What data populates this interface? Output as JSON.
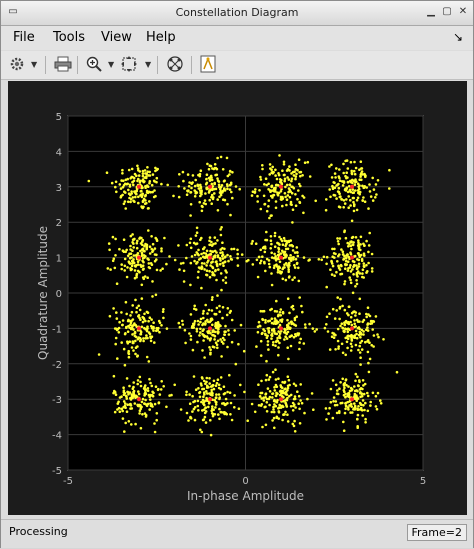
{
  "window": {
    "title": "Constellation Diagram"
  },
  "menu": {
    "file": "File",
    "tools": "Tools",
    "view": "View",
    "help": "Help"
  },
  "toolbar": {
    "icons": [
      "settings-icon",
      "print-icon",
      "zoom-in-icon",
      "autoscale-icon",
      "reference-constellation-icon",
      "highlight-icon"
    ]
  },
  "status": {
    "message": "Processing",
    "frame": "Frame=2"
  },
  "chart_data": {
    "type": "scatter",
    "xlabel": "In-phase Amplitude",
    "ylabel": "Quadrature Amplitude",
    "xlim": [
      -5,
      5
    ],
    "ylim": [
      -5,
      5
    ],
    "x_ticks": [
      "-5",
      "0",
      "5"
    ],
    "y_ticks": [
      "5",
      "4",
      "3",
      "2",
      "1",
      "0",
      "-1",
      "-2",
      "-3",
      "-4",
      "-5"
    ],
    "grid": true,
    "background": "#000000",
    "point_color": "#ffff33",
    "reference_color": "#ff2a2a",
    "reference_points": [
      {
        "x": -3,
        "y": 3
      },
      {
        "x": -1,
        "y": 3
      },
      {
        "x": 1,
        "y": 3
      },
      {
        "x": 3,
        "y": 3
      },
      {
        "x": -3,
        "y": 1
      },
      {
        "x": -1,
        "y": 1
      },
      {
        "x": 1,
        "y": 1
      },
      {
        "x": 3,
        "y": 1
      },
      {
        "x": -3,
        "y": -1
      },
      {
        "x": -1,
        "y": -1
      },
      {
        "x": 1,
        "y": -1
      },
      {
        "x": 3,
        "y": -1
      },
      {
        "x": -3,
        "y": -3
      },
      {
        "x": -1,
        "y": -3
      },
      {
        "x": 1,
        "y": -3
      },
      {
        "x": 3,
        "y": -3
      }
    ]
  }
}
